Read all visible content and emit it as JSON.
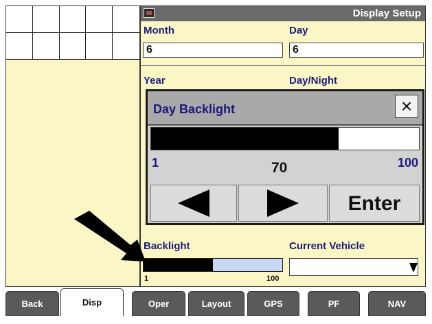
{
  "header": {
    "title": "Display Setup",
    "icon": "display-icon"
  },
  "fields": {
    "month": {
      "label": "Month",
      "value": "6"
    },
    "day": {
      "label": "Day",
      "value": "6"
    },
    "year": {
      "label": "Year"
    },
    "day_night": {
      "label": "Day/Night"
    },
    "backlight": {
      "label": "Backlight",
      "min": "1",
      "max": "100",
      "level": 0.5
    },
    "current_vehicle": {
      "label": "Current Vehicle"
    }
  },
  "popup": {
    "title": "Day Backlight",
    "close_label": "×",
    "min": "1",
    "max": "100",
    "value": "70",
    "level": 0.7,
    "enter_label": "Enter"
  },
  "tabs": [
    {
      "label": "Back"
    },
    {
      "label": "Disp"
    },
    {
      "label": "Oper"
    },
    {
      "label": "Layout"
    },
    {
      "label": "GPS"
    },
    {
      "label": "PF"
    },
    {
      "label": "NAV"
    }
  ],
  "colors": {
    "panel_bg": "#fbf6c6",
    "label_text": "#1b1a7a",
    "titlebar": "#6a6a6a",
    "tab_bg": "#5a5a5a"
  }
}
